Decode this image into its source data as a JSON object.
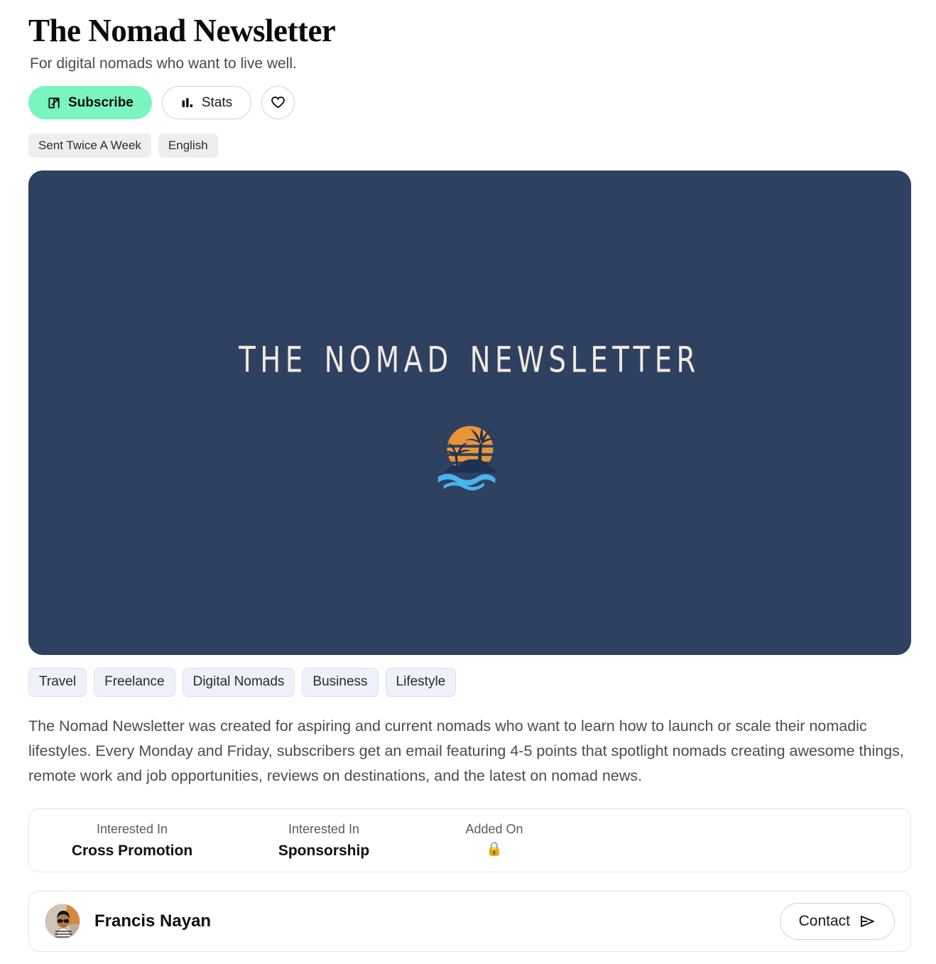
{
  "header": {
    "title": "The Nomad Newsletter",
    "tagline": "For digital nomads who want to live well."
  },
  "actions": {
    "subscribe_label": "Subscribe",
    "subscribe_icon": "external-link-icon",
    "subscribe_color": "#7af5c0",
    "stats_label": "Stats",
    "stats_icon": "bar-chart-icon",
    "favorite_icon": "heart-icon"
  },
  "meta_chips": [
    {
      "label": "Sent Twice A Week"
    },
    {
      "label": "English"
    }
  ],
  "hero": {
    "wordmark": "The Nomad Newsletter",
    "background_color": "#2f4161",
    "wordmark_color": "#f2e9df",
    "logo_icon": "palm-island-sunset-icon",
    "logo_sun_color": "#e8953a",
    "logo_silhouette_color": "#1f3152",
    "logo_wave_color": "#49b4ed"
  },
  "tags": [
    {
      "label": "Travel"
    },
    {
      "label": "Freelance"
    },
    {
      "label": "Digital Nomads"
    },
    {
      "label": "Business"
    },
    {
      "label": "Lifestyle"
    }
  ],
  "description": "The Nomad Newsletter was created for aspiring and current nomads who want to learn how to launch or scale their nomadic lifestyles. Every Monday and Friday, subscribers get an email featuring 4-5 points that spotlight nomads creating awesome things, remote work and job opportunities, reviews on destinations, and the latest on nomad news.",
  "info_card": {
    "columns": [
      {
        "label": "Interested In",
        "value": "Cross Promotion"
      },
      {
        "label": "Interested In",
        "value": "Sponsorship"
      },
      {
        "label": "Added On",
        "value": "🔒"
      }
    ]
  },
  "author": {
    "name": "Francis Nayan",
    "avatar_icon": "user-avatar-photo",
    "contact_label": "Contact",
    "contact_icon": "send-icon"
  }
}
